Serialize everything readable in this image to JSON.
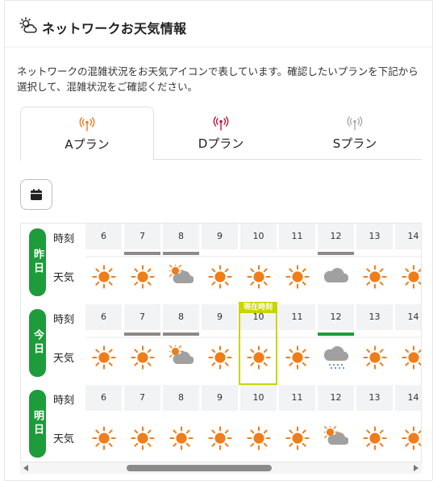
{
  "header": {
    "title": "ネットワークお天気情報",
    "icon": "network-weather-icon"
  },
  "description": "ネットワークの混雑状況をお天気アイコンで表しています。確認したいプランを下記から選択して、混雑状況をご確認ください。",
  "tabs": [
    {
      "label": "Aプラン",
      "icon": "antenna-icon",
      "color": "#e67e22",
      "active": true
    },
    {
      "label": "Dプラン",
      "icon": "antenna-icon",
      "color": "#c0143c",
      "active": false
    },
    {
      "label": "Sプラン",
      "icon": "antenna-icon",
      "color": "#aaaaaa",
      "active": false
    }
  ],
  "calendar_button": {
    "icon": "calendar-icon"
  },
  "row_labels": {
    "time": "時刻",
    "weather": "天気"
  },
  "now_label": "現在時刻",
  "hours": [
    "6",
    "7",
    "8",
    "9",
    "10",
    "11",
    "12",
    "13",
    "14"
  ],
  "days": [
    {
      "label": "昨日",
      "weather": [
        "sunny",
        "sunny",
        "sunny-cloudy",
        "sunny",
        "sunny",
        "sunny",
        "cloudy",
        "sunny",
        "sunny"
      ],
      "congestion_bars": [
        "none",
        "gray",
        "gray",
        "none",
        "none",
        "none",
        "gray",
        "none",
        "none"
      ]
    },
    {
      "label": "今日",
      "weather": [
        "sunny",
        "sunny",
        "sunny-cloudy",
        "sunny",
        "sunny",
        "sunny",
        "cloudy-rain",
        "sunny",
        "sunny"
      ],
      "congestion_bars": [
        "none",
        "gray",
        "gray",
        "none",
        "none",
        "none",
        "green",
        "none",
        "none"
      ]
    },
    {
      "label": "明日",
      "weather": [
        "sunny",
        "sunny",
        "sunny",
        "sunny",
        "sunny",
        "sunny",
        "sunny-cloudy",
        "sunny",
        "sunny"
      ],
      "congestion_bars": [
        "none",
        "none",
        "none",
        "none",
        "none",
        "none",
        "none",
        "none",
        "none"
      ]
    }
  ],
  "colors": {
    "badge_green": "#1e9b3a",
    "sun": "#ef7d1a",
    "cloud": "#a0a0a0",
    "now_highlight": "#c9d400",
    "bar_gray": "#8a8a8a",
    "bar_green": "#1e9b3a"
  }
}
